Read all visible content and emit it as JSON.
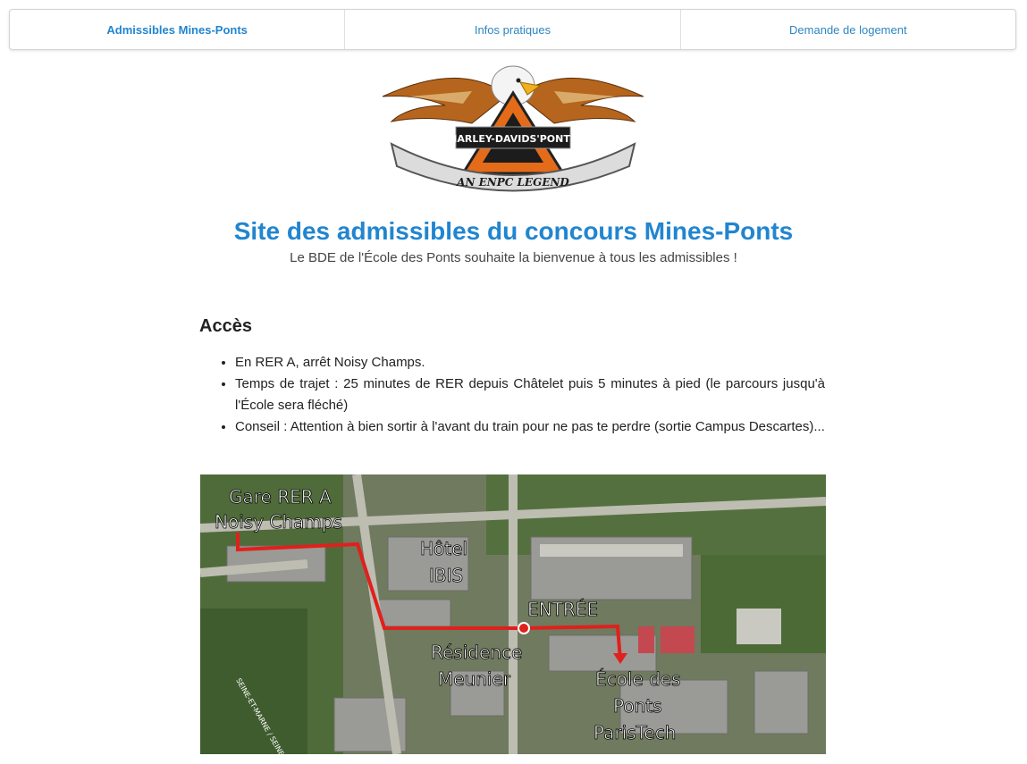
{
  "nav": {
    "tabs": [
      {
        "label": "Admissibles Mines-Ponts"
      },
      {
        "label": "Infos pratiques"
      },
      {
        "label": "Demande de logement"
      }
    ]
  },
  "logo": {
    "top_text": "HARLEY-DAVIDS'PONTS",
    "bottom_text": "AN ENPC LEGEND"
  },
  "header": {
    "title": "Site des admissibles du concours Mines-Ponts",
    "subtitle": "Le BDE de l'École des Ponts souhaite la bienvenue à tous les admissibles !"
  },
  "access": {
    "title": "Accès",
    "items": [
      "En RER A, arrêt Noisy Champs.",
      "Temps de trajet : 25 minutes de RER depuis Châtelet puis 5 minutes à pied (le parcours jusqu'à l'École sera fléché)",
      "Conseil : Attention à bien sortir à l'avant du train pour ne pas te perdre (sortie Campus Descartes)..."
    ]
  },
  "map": {
    "labels": {
      "gare_line1": "Gare RER A",
      "gare_line2": "Noisy Champs",
      "hotel_line1": "Hôtel",
      "hotel_line2": "IBIS",
      "entree": "ENTRÉE",
      "residence_line1": "Résidence",
      "residence_line2": "Meunier",
      "ecole_line1": "École des",
      "ecole_line2": "Ponts",
      "ecole_line3": "ParisTech",
      "dept": "SEINE-ET-MARNE / SEINE-SAINT-DENIS"
    },
    "route_color": "#e0201c"
  }
}
